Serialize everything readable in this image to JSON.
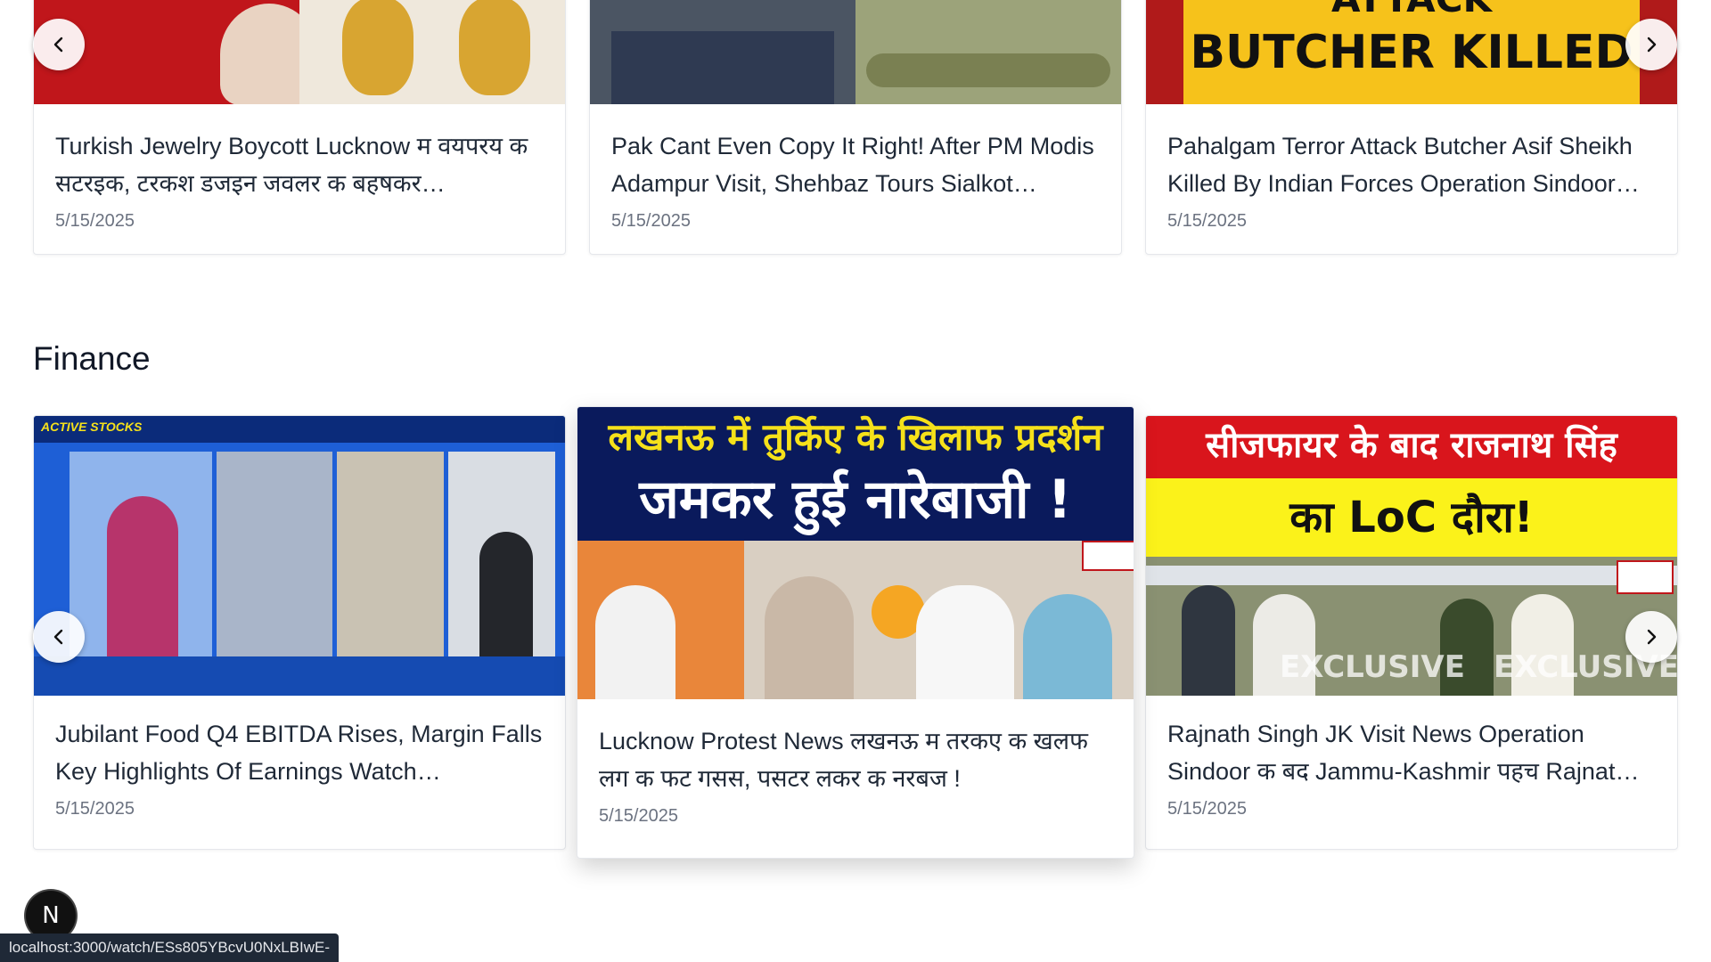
{
  "top_row": {
    "cards": [
      {
        "title": "Turkish Jewelry Boycott Lucknow म वयपरय क सटरइक, टरकश डजइन जवलर क बहषकर…",
        "date": "5/15/2025",
        "thumb_colors": [
          "#c0161b",
          "#efe8dc"
        ]
      },
      {
        "title": "Pak Cant Even Copy It Right! After PM Modis Adampur Visit, Shehbaz Tours Sialkot…",
        "date": "5/15/2025",
        "thumb_colors": [
          "#4b5563",
          "#9ca37a"
        ]
      },
      {
        "title": "Pahalgam Terror Attack Butcher Asif Sheikh Killed By Indian Forces Operation Sindoor…",
        "date": "5/15/2025",
        "thumb_colors": [
          "#f6c21b",
          "#b01a1a"
        ],
        "thumb_text": [
          "ATTACK",
          "BUTCHER KILLED"
        ]
      }
    ],
    "prev_icon": "chevron-left-icon",
    "next_icon": "chevron-right-icon"
  },
  "finance": {
    "title": "Finance",
    "cards": [
      {
        "title": "Jubilant Food Q4 EBITDA Rises, Margin Falls Key Highlights Of Earnings Watch Business…",
        "date": "5/15/2025",
        "thumb_colors": [
          "#1e5fd6",
          "#0b2b7a"
        ],
        "thumb_text": [
          "ACTIVE STOCKS"
        ]
      },
      {
        "title": "Lucknow Protest News लखनऊ म तरकए क खलफ लग क फट गसस, पसटर लकर क नरबज !",
        "date": "5/15/2025",
        "thumb_colors": [
          "#0a1a5c",
          "#f6e11a"
        ],
        "thumb_text": [
          "लखनऊ में तुर्किए के खिलाफ प्रदर्शन",
          "जमकर हुई नारेबाजी !"
        ]
      },
      {
        "title": "Rajnath Singh JK Visit News Operation Sindoor क बद Jammu-Kashmir पहच Rajnat…",
        "date": "5/15/2025",
        "thumb_colors": [
          "#d9151c",
          "#fbf21a"
        ],
        "thumb_text": [
          "सीजफायर के बाद राजनाथ सिंह",
          "का LoC दौरा!",
          "EXCLUSIVE"
        ]
      }
    ]
  },
  "badge": {
    "letter": "N",
    "icon": "nextjs-logo-icon"
  },
  "status_bar": {
    "url": "localhost:3000/watch/ESs805YBcvU0NxLBIwE-"
  },
  "colors": {
    "card_border": "#e5e7eb",
    "text": "#1f2937",
    "date": "#6b7280"
  }
}
